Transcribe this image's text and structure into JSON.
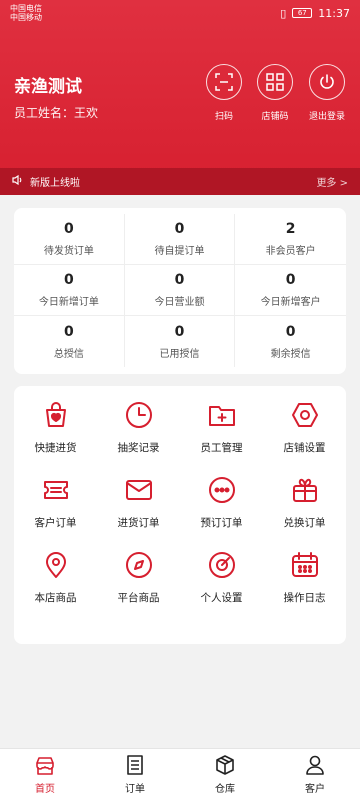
{
  "status": {
    "carrier1": "中国电信",
    "carrier2": "中国移动",
    "battery": "67",
    "time": "11:37"
  },
  "header": {
    "company": "亲渔测试",
    "employee": "员工姓名：王欢",
    "buttons": [
      {
        "label": "扫码",
        "icon": "scan-icon"
      },
      {
        "label": "店铺码",
        "icon": "qrcode-icon"
      },
      {
        "label": "退出登录",
        "icon": "power-icon"
      }
    ]
  },
  "notice": {
    "text": "新版上线啦",
    "more": "更多 >"
  },
  "stats": [
    {
      "value": "0",
      "label": "待发货订单"
    },
    {
      "value": "0",
      "label": "待自提订单"
    },
    {
      "value": "2",
      "label": "非会员客户"
    },
    {
      "value": "0",
      "label": "今日新增订单"
    },
    {
      "value": "0",
      "label": "今日营业额"
    },
    {
      "value": "0",
      "label": "今日新增客户"
    },
    {
      "value": "0",
      "label": "总授信"
    },
    {
      "value": "0",
      "label": "已用授信"
    },
    {
      "value": "0",
      "label": "剩余授信"
    }
  ],
  "menu": [
    {
      "label": "快捷进货",
      "icon": "shopping-bag-icon"
    },
    {
      "label": "抽奖记录",
      "icon": "clock-icon"
    },
    {
      "label": "员工管理",
      "icon": "folder-plus-icon"
    },
    {
      "label": "店铺设置",
      "icon": "hexagon-settings-icon"
    },
    {
      "label": "客户订单",
      "icon": "ticket-icon"
    },
    {
      "label": "进货订单",
      "icon": "mail-icon"
    },
    {
      "label": "预订订单",
      "icon": "chat-dots-icon"
    },
    {
      "label": "兑换订单",
      "icon": "gift-icon"
    },
    {
      "label": "本店商品",
      "icon": "location-pin-icon"
    },
    {
      "label": "平台商品",
      "icon": "compass-icon"
    },
    {
      "label": "个人设置",
      "icon": "target-icon"
    },
    {
      "label": "操作日志",
      "icon": "calendar-icon"
    }
  ],
  "tabs": [
    {
      "label": "首页",
      "icon": "store-icon",
      "active": true
    },
    {
      "label": "订单",
      "icon": "document-icon",
      "active": false
    },
    {
      "label": "仓库",
      "icon": "box-icon",
      "active": false
    },
    {
      "label": "客户",
      "icon": "user-icon",
      "active": false
    }
  ],
  "colors": {
    "accent": "#d61f2f",
    "notice_bg": "#b01625"
  }
}
